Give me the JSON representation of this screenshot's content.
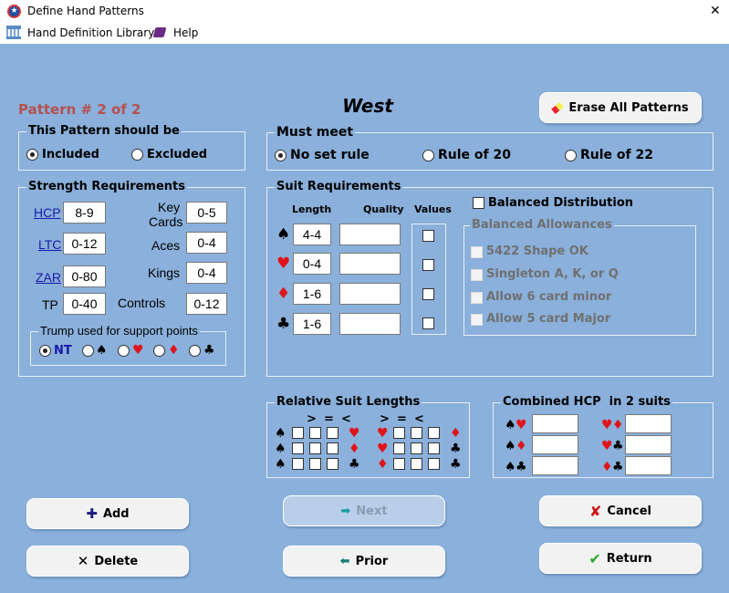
{
  "window": {
    "title": "Define Hand Patterns",
    "close": "✕"
  },
  "menu": {
    "library": "Hand Definition Library",
    "help": "Help"
  },
  "pattern_label": "Pattern # 2 of 2",
  "seat": "West",
  "erase_label": "Erase All Patterns",
  "inclusion": {
    "title": "This Pattern should be",
    "included": "Included",
    "excluded": "Excluded",
    "selected": "Included"
  },
  "must_meet": {
    "title": "Must meet",
    "options": [
      "No set rule",
      "Rule of 20",
      "Rule of 22"
    ],
    "selected": "No set rule"
  },
  "strength": {
    "title": "Strength Requirements",
    "hcp": {
      "label": "HCP",
      "value": "8-9"
    },
    "ltc": {
      "label": "LTC",
      "value": "0-12"
    },
    "zar": {
      "label": "ZAR",
      "value": "0-80"
    },
    "tp": {
      "label": "TP",
      "value": "0-40"
    },
    "key_cards": {
      "label1": "Key",
      "label2": "Cards",
      "value": "0-5"
    },
    "aces": {
      "label": "Aces",
      "value": "0-4"
    },
    "kings": {
      "label": "Kings",
      "value": "0-4"
    },
    "controls": {
      "label": "Controls",
      "value": "0-12"
    },
    "trump": {
      "title": "Trump used for support points",
      "nt": "NT",
      "selected": "NT"
    }
  },
  "suits": {
    "spade": "♠",
    "heart": "♥",
    "diamond": "♦",
    "club": "♣"
  },
  "suit_req": {
    "title": "Suit Requirements",
    "length": "Length",
    "quality": "Quality",
    "values": "Values",
    "lengths": [
      "4-4",
      "0-4",
      "1-6",
      "1-6"
    ],
    "qualities": [
      "",
      "",
      "",
      ""
    ]
  },
  "balanced": {
    "label": "Balanced Distribution",
    "allowances_title": "Balanced Allowances",
    "options": [
      "5422 Shape OK",
      "Singleton A, K, or Q",
      "Allow 6 card minor",
      "Allow 5 card Major"
    ]
  },
  "relative": {
    "title": "Relative Suit Lengths",
    "gt": ">",
    "eq": "=",
    "lt": "<"
  },
  "combined": {
    "title": "Combined HCP  in 2 suits"
  },
  "buttons": {
    "add": "Add",
    "delete": "Delete",
    "next": "Next",
    "prior": "Prior",
    "cancel": "Cancel",
    "return": "Return"
  },
  "colors": {
    "background": "#8ab0db",
    "pattern_label": "#b5514f",
    "red_suit": "#e0141b",
    "link": "#1a1aa6"
  }
}
